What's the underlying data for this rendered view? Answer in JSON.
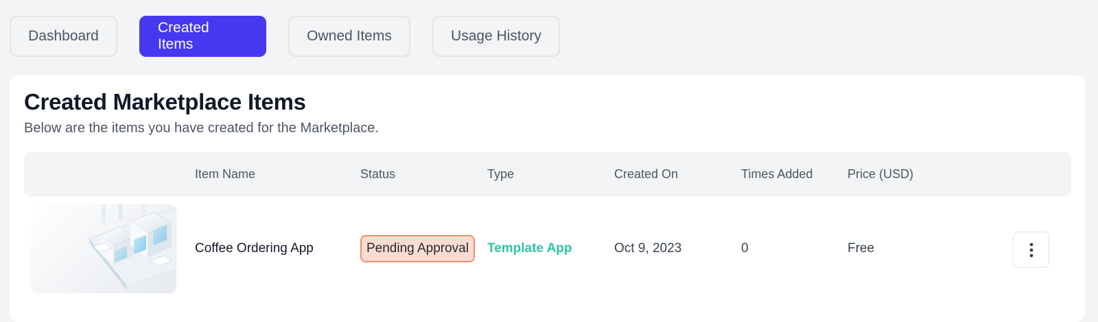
{
  "tabs": [
    {
      "label": "Dashboard",
      "active": false
    },
    {
      "label": "Created Items",
      "active": true
    },
    {
      "label": "Owned Items",
      "active": false
    },
    {
      "label": "Usage History",
      "active": false
    }
  ],
  "section": {
    "title": "Created Marketplace Items",
    "subtitle": "Below are the items you have created for the Marketplace."
  },
  "table": {
    "headers": [
      "Item Name",
      "Status",
      "Type",
      "Created On",
      "Times Added",
      "Price (USD)"
    ],
    "rows": [
      {
        "thumbnail": "isometric-building-thumbnail",
        "item_name": "Coffee Ordering App",
        "status": "Pending Approval",
        "type": "Template App",
        "created_on": "Oct 9, 2023",
        "times_added": "0",
        "price": "Free",
        "menu_icon": "more-vertical-icon"
      }
    ]
  },
  "colors": {
    "accent": "#4438f0",
    "status_pending_bg": "#fcdcd0",
    "status_pending_border": "#ef8f6b",
    "type_link": "#2ec4a4"
  }
}
